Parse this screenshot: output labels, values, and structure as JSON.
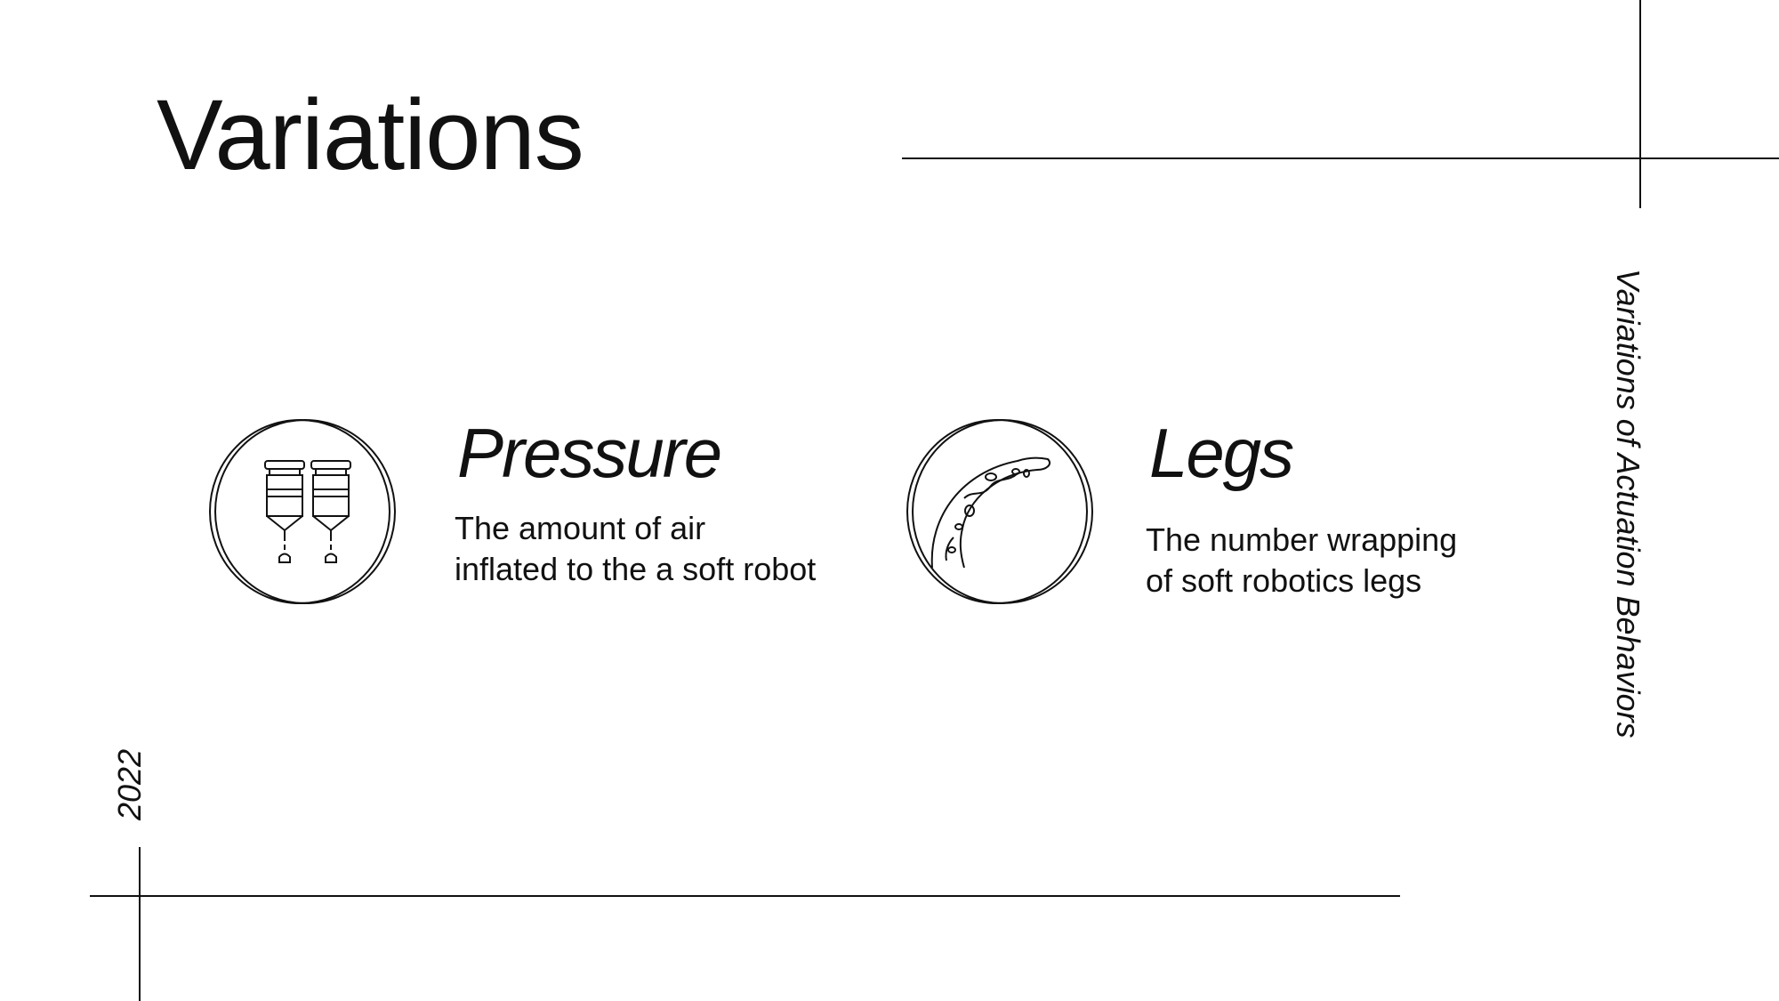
{
  "slide": {
    "title": "Variations",
    "side_label": "Variations of Actuation Behaviors",
    "year": "2022"
  },
  "features": [
    {
      "title": "Pressure",
      "description_lines": [
        "The amount of air",
        "inflated to the a soft robot"
      ],
      "icon": "pressure-syringes-icon"
    },
    {
      "title": "Legs",
      "description_lines": [
        "The number wrapping",
        "of soft robotics legs"
      ],
      "icon": "soft-robot-leg-icon"
    }
  ]
}
